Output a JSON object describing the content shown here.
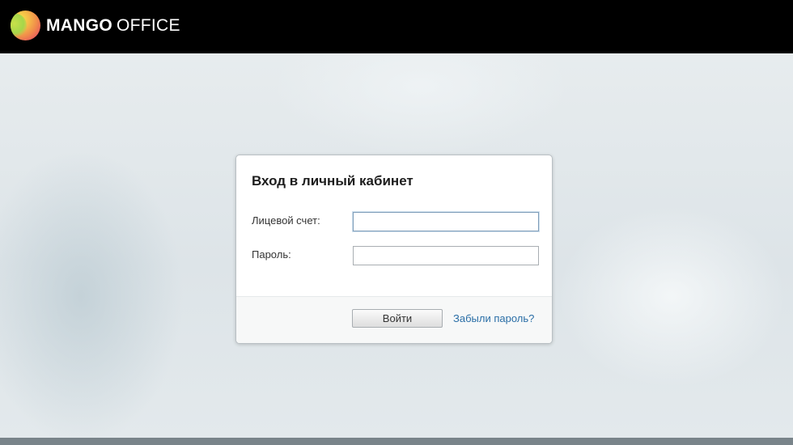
{
  "header": {
    "logo_primary": "MANGO",
    "logo_secondary": "OFFICE"
  },
  "login": {
    "title": "Вход в личный кабинет",
    "account_label": "Лицевой счет:",
    "account_value": "",
    "password_label": "Пароль:",
    "password_value": "",
    "submit_label": "Войти",
    "forgot_label": "Забыли пароль?"
  },
  "colors": {
    "topbar": "#000000",
    "link": "#2a6ea6",
    "background": "#dfe6e9"
  }
}
